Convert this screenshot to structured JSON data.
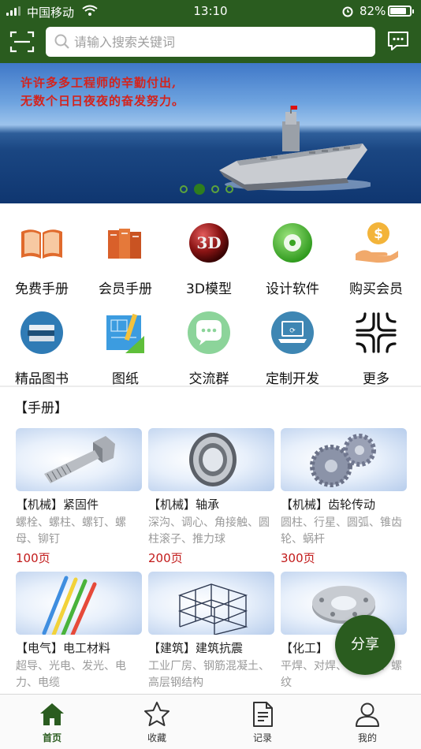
{
  "status_bar": {
    "carrier": "中国移动",
    "time": "13:10",
    "battery": "82%",
    "battery_level": 0.82
  },
  "header": {
    "scan_icon": "scan-icon",
    "search_placeholder": "请输入搜索关键词",
    "message_icon": "message-icon",
    "bg_color": "#2a5c1f"
  },
  "banner": {
    "line1": "许许多多工程师的辛勤付出,",
    "line2": "无数个日日夜夜的奋发努力。",
    "slides": 4,
    "active_slide": 2
  },
  "quick_entries": [
    {
      "label": "免费手册",
      "icon": "open-book-icon"
    },
    {
      "label": "会员手册",
      "icon": "books-icon"
    },
    {
      "label": "3D模型",
      "icon": "3d-icon"
    },
    {
      "label": "设计软件",
      "icon": "disc-icon"
    },
    {
      "label": "购买会员",
      "icon": "dollar-hand-icon"
    },
    {
      "label": "精品图书",
      "icon": "book-stack-icon"
    },
    {
      "label": "图纸",
      "icon": "blueprint-icon"
    },
    {
      "label": "交流群",
      "icon": "chat-bubble-icon"
    },
    {
      "label": "定制开发",
      "icon": "laptop-icon"
    },
    {
      "label": "更多",
      "icon": "more-knot-icon"
    }
  ],
  "section_title": "【手册】",
  "cards": [
    {
      "title": "【机械】紧固件",
      "desc": "螺栓、螺柱、螺钉、螺母、铆钉",
      "pages": "100页",
      "icon": "bolt-icon"
    },
    {
      "title": "【机械】轴承",
      "desc": "深沟、调心、角接触、圆柱滚子、推力球",
      "pages": "200页",
      "icon": "bearing-icon"
    },
    {
      "title": "【机械】齿轮传动",
      "desc": "圆柱、行星、圆弧、锥齿轮、蜗杆",
      "pages": "300页",
      "icon": "gears-icon"
    },
    {
      "title": "【电气】电工材料",
      "desc": "超导、光电、发光、电力、电缆",
      "pages": "",
      "icon": "wires-icon"
    },
    {
      "title": "【建筑】建筑抗震",
      "desc": "工业厂房、钢筋混凝土、高层钢结构",
      "pages": "",
      "icon": "steel-frame-icon"
    },
    {
      "title": "【化工】",
      "desc": "平焊、对焊、长高颈、螺纹",
      "pages": "",
      "icon": "flange-icon"
    }
  ],
  "share_button": "分享",
  "tabs": [
    {
      "label": "首页",
      "icon": "home-icon",
      "active": true
    },
    {
      "label": "收藏",
      "icon": "star-icon",
      "active": false
    },
    {
      "label": "记录",
      "icon": "document-icon",
      "active": false
    },
    {
      "label": "我的",
      "icon": "user-icon",
      "active": false
    }
  ]
}
